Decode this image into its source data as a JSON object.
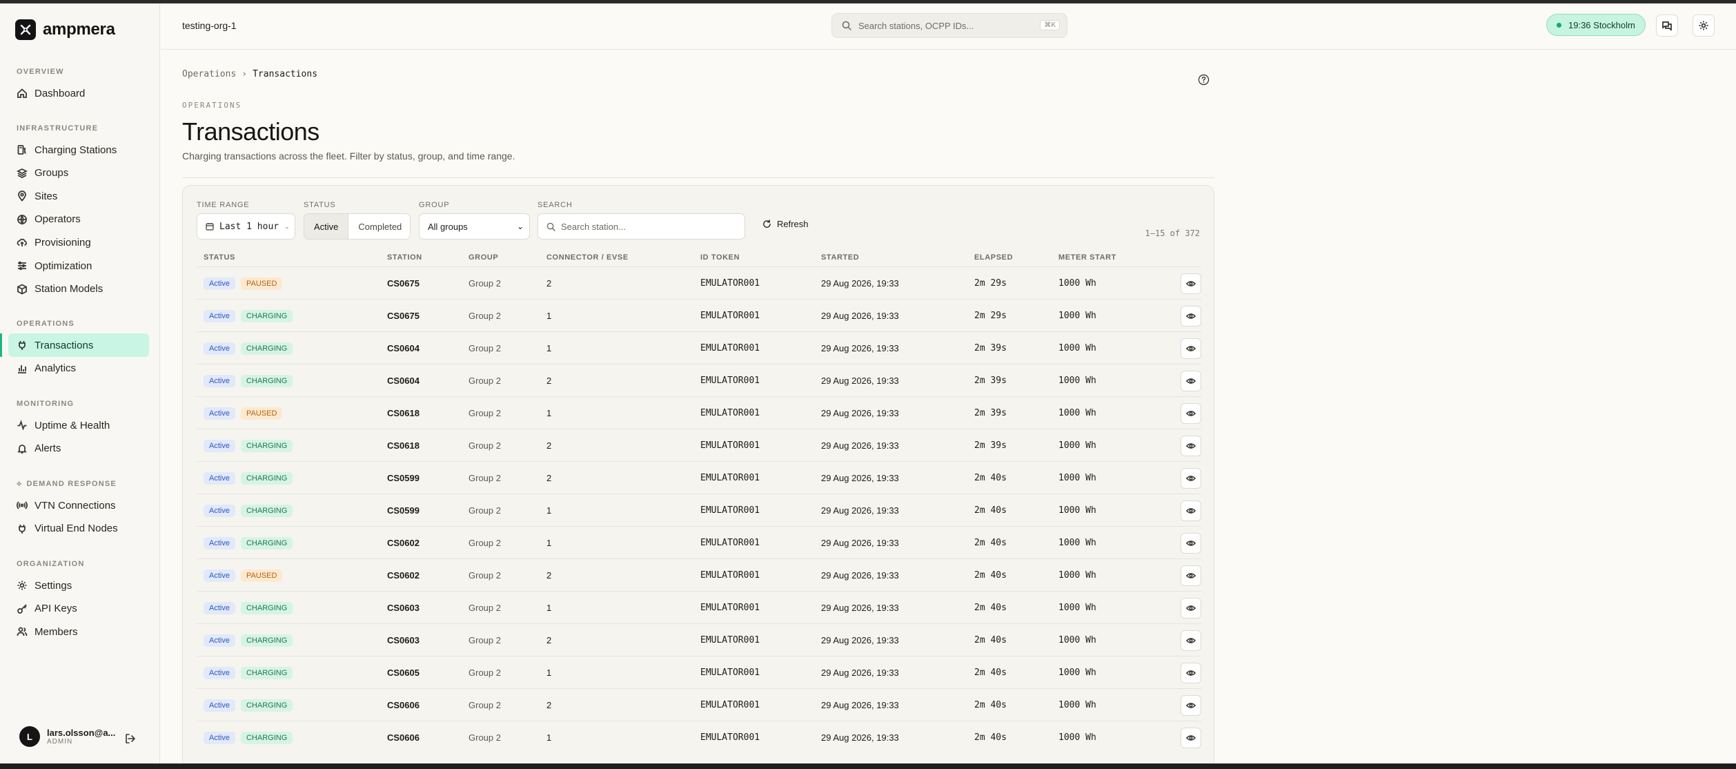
{
  "app": {
    "name": "ampmera"
  },
  "sidebar": {
    "sections": [
      {
        "title": "OVERVIEW",
        "items": [
          {
            "label": "Dashboard",
            "icon": "home-icon"
          }
        ]
      },
      {
        "title": "INFRASTRUCTURE",
        "items": [
          {
            "label": "Charging Stations",
            "icon": "charger-icon"
          },
          {
            "label": "Groups",
            "icon": "layers-icon"
          },
          {
            "label": "Sites",
            "icon": "map-pin-icon"
          },
          {
            "label": "Operators",
            "icon": "globe-icon"
          },
          {
            "label": "Provisioning",
            "icon": "cloud-upload-icon"
          },
          {
            "label": "Optimization",
            "icon": "sliders-icon"
          },
          {
            "label": "Station Models",
            "icon": "cube-icon"
          }
        ]
      },
      {
        "title": "OPERATIONS",
        "items": [
          {
            "label": "Transactions",
            "icon": "plug-icon",
            "active": true
          },
          {
            "label": "Analytics",
            "icon": "bar-chart-icon"
          }
        ]
      },
      {
        "title": "MONITORING",
        "items": [
          {
            "label": "Uptime & Health",
            "icon": "activity-icon"
          },
          {
            "label": "Alerts",
            "icon": "bell-icon"
          }
        ]
      },
      {
        "title": "DEMAND RESPONSE",
        "items": [
          {
            "label": "VTN Connections",
            "icon": "broadcast-icon"
          },
          {
            "label": "Virtual End Nodes",
            "icon": "plug-icon"
          }
        ]
      },
      {
        "title": "ORGANIZATION",
        "items": [
          {
            "label": "Settings",
            "icon": "gear-icon"
          },
          {
            "label": "API Keys",
            "icon": "key-icon"
          },
          {
            "label": "Members",
            "icon": "users-icon"
          }
        ]
      }
    ],
    "user": {
      "initial": "L",
      "name": "lars.olsson@a...",
      "role": "ADMIN"
    }
  },
  "header": {
    "org": "testing-org-1",
    "search_placeholder": "Search stations, OCPP IDs...",
    "search_shortcut": "⌘K",
    "clock": "19:36 Stockholm"
  },
  "page": {
    "breadcrumb": [
      "Operations",
      "Transactions"
    ],
    "eyebrow": "OPERATIONS",
    "title": "Transactions",
    "subtitle": "Charging transactions across the fleet. Filter by status, group, and time range."
  },
  "filters": {
    "time_range_label": "TIME RANGE",
    "time_range_value": "Last 1 hour",
    "status_label": "STATUS",
    "status_options": [
      "Active",
      "Completed"
    ],
    "group_label": "GROUP",
    "group_value": "All groups",
    "search_label": "SEARCH",
    "search_placeholder": "Search station...",
    "refresh_label": "Refresh",
    "count": "1–15 of 372"
  },
  "table": {
    "columns": [
      "STATUS",
      "STATION",
      "GROUP",
      "CONNECTOR / EVSE",
      "ID TOKEN",
      "STARTED",
      "ELAPSED",
      "METER START"
    ],
    "rows": [
      {
        "status": "Active",
        "state": "PAUSED",
        "station": "CS0675",
        "group": "Group 2",
        "connector": "2",
        "token": "EMULATOR001",
        "started": "29 Aug 2026, 19:33",
        "elapsed": "2m 29s",
        "meter": "1000 Wh"
      },
      {
        "status": "Active",
        "state": "CHARGING",
        "station": "CS0675",
        "group": "Group 2",
        "connector": "1",
        "token": "EMULATOR001",
        "started": "29 Aug 2026, 19:33",
        "elapsed": "2m 29s",
        "meter": "1000 Wh"
      },
      {
        "status": "Active",
        "state": "CHARGING",
        "station": "CS0604",
        "group": "Group 2",
        "connector": "1",
        "token": "EMULATOR001",
        "started": "29 Aug 2026, 19:33",
        "elapsed": "2m 39s",
        "meter": "1000 Wh"
      },
      {
        "status": "Active",
        "state": "CHARGING",
        "station": "CS0604",
        "group": "Group 2",
        "connector": "2",
        "token": "EMULATOR001",
        "started": "29 Aug 2026, 19:33",
        "elapsed": "2m 39s",
        "meter": "1000 Wh"
      },
      {
        "status": "Active",
        "state": "PAUSED",
        "station": "CS0618",
        "group": "Group 2",
        "connector": "1",
        "token": "EMULATOR001",
        "started": "29 Aug 2026, 19:33",
        "elapsed": "2m 39s",
        "meter": "1000 Wh"
      },
      {
        "status": "Active",
        "state": "CHARGING",
        "station": "CS0618",
        "group": "Group 2",
        "connector": "2",
        "token": "EMULATOR001",
        "started": "29 Aug 2026, 19:33",
        "elapsed": "2m 39s",
        "meter": "1000 Wh"
      },
      {
        "status": "Active",
        "state": "CHARGING",
        "station": "CS0599",
        "group": "Group 2",
        "connector": "2",
        "token": "EMULATOR001",
        "started": "29 Aug 2026, 19:33",
        "elapsed": "2m 40s",
        "meter": "1000 Wh"
      },
      {
        "status": "Active",
        "state": "CHARGING",
        "station": "CS0599",
        "group": "Group 2",
        "connector": "1",
        "token": "EMULATOR001",
        "started": "29 Aug 2026, 19:33",
        "elapsed": "2m 40s",
        "meter": "1000 Wh"
      },
      {
        "status": "Active",
        "state": "CHARGING",
        "station": "CS0602",
        "group": "Group 2",
        "connector": "1",
        "token": "EMULATOR001",
        "started": "29 Aug 2026, 19:33",
        "elapsed": "2m 40s",
        "meter": "1000 Wh"
      },
      {
        "status": "Active",
        "state": "PAUSED",
        "station": "CS0602",
        "group": "Group 2",
        "connector": "2",
        "token": "EMULATOR001",
        "started": "29 Aug 2026, 19:33",
        "elapsed": "2m 40s",
        "meter": "1000 Wh"
      },
      {
        "status": "Active",
        "state": "CHARGING",
        "station": "CS0603",
        "group": "Group 2",
        "connector": "1",
        "token": "EMULATOR001",
        "started": "29 Aug 2026, 19:33",
        "elapsed": "2m 40s",
        "meter": "1000 Wh"
      },
      {
        "status": "Active",
        "state": "CHARGING",
        "station": "CS0603",
        "group": "Group 2",
        "connector": "2",
        "token": "EMULATOR001",
        "started": "29 Aug 2026, 19:33",
        "elapsed": "2m 40s",
        "meter": "1000 Wh"
      },
      {
        "status": "Active",
        "state": "CHARGING",
        "station": "CS0605",
        "group": "Group 2",
        "connector": "1",
        "token": "EMULATOR001",
        "started": "29 Aug 2026, 19:33",
        "elapsed": "2m 40s",
        "meter": "1000 Wh"
      },
      {
        "status": "Active",
        "state": "CHARGING",
        "station": "CS0606",
        "group": "Group 2",
        "connector": "2",
        "token": "EMULATOR001",
        "started": "29 Aug 2026, 19:33",
        "elapsed": "2m 40s",
        "meter": "1000 Wh"
      },
      {
        "status": "Active",
        "state": "CHARGING",
        "station": "CS0606",
        "group": "Group 2",
        "connector": "1",
        "token": "EMULATOR001",
        "started": "29 Aug 2026, 19:33",
        "elapsed": "2m 40s",
        "meter": "1000 Wh"
      }
    ]
  },
  "colors": {
    "accent": "#1fb584",
    "active_nav_bg": "#c9f5e4",
    "charging": "#1a7a4e",
    "paused": "#b3620f",
    "active": "#3055c2"
  }
}
